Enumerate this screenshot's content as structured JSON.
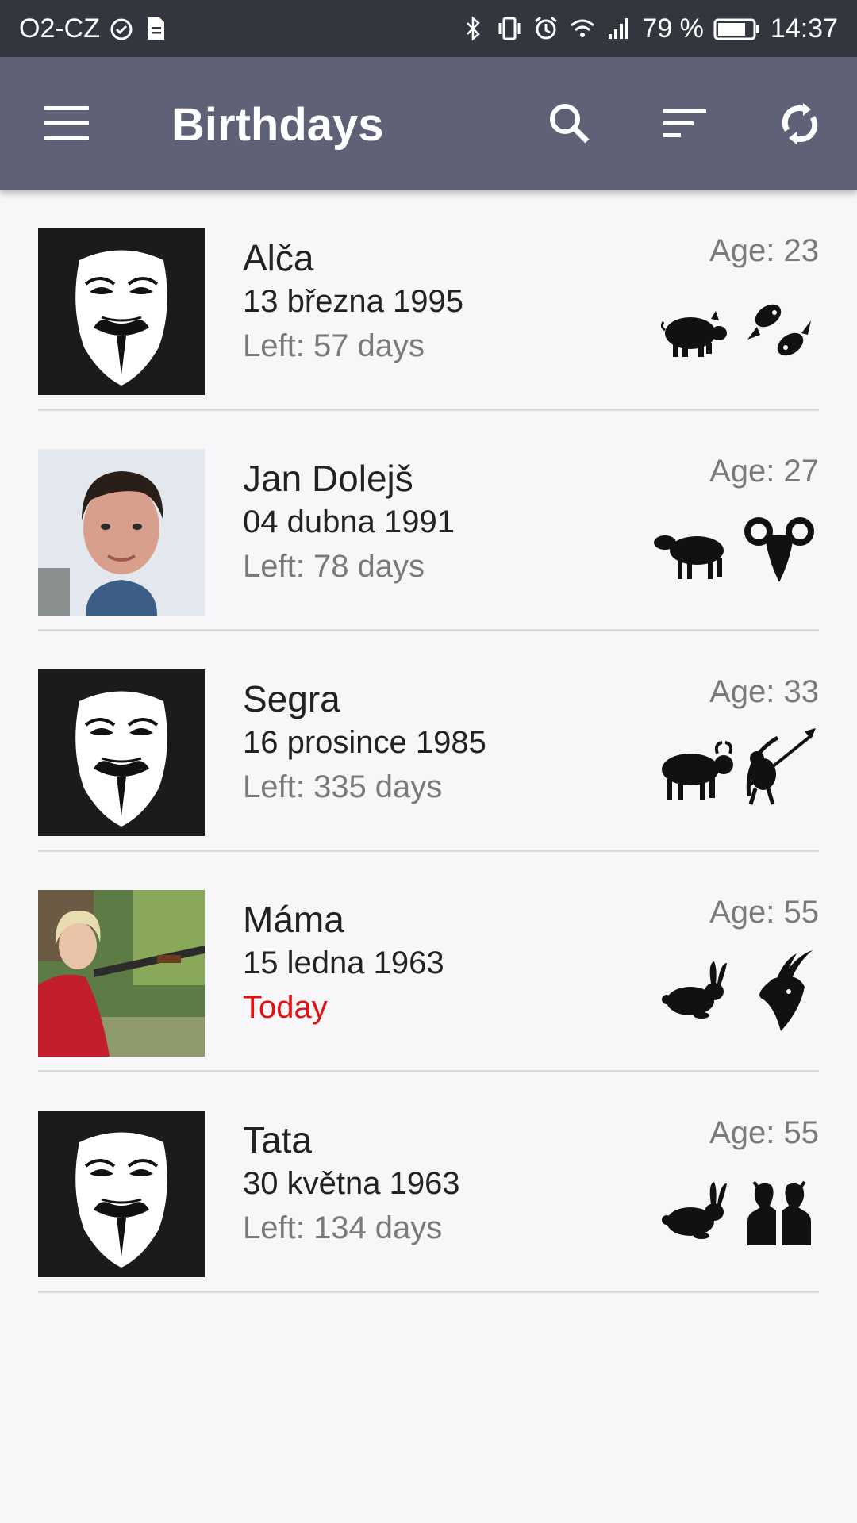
{
  "status_bar": {
    "carrier": "O2-CZ",
    "battery": "79 %",
    "time": "14:37"
  },
  "app_bar": {
    "title": "Birthdays",
    "icons": [
      "menu-icon",
      "search-icon",
      "sort-icon",
      "sync-icon"
    ]
  },
  "people": [
    {
      "name": "Alča",
      "date": "13 března 1995",
      "left": "Left: 57 days",
      "age": "Age: 23",
      "avatar": "mask",
      "chinese_zodiac": "pig-icon",
      "zodiac": "pisces-icon"
    },
    {
      "name": "Jan Dolejš",
      "date": "04 dubna 1991",
      "left": "Left: 78 days",
      "age": "Age: 27",
      "avatar": "photo-man",
      "chinese_zodiac": "sheep-icon",
      "zodiac": "aries-icon"
    },
    {
      "name": "Segra",
      "date": "16 prosince 1985",
      "left": "Left: 335 days",
      "age": "Age: 33",
      "avatar": "mask",
      "chinese_zodiac": "ox-icon",
      "zodiac": "sagittarius-icon"
    },
    {
      "name": "Máma",
      "date": "15 ledna 1963",
      "left": "Today",
      "age": "Age: 55",
      "avatar": "photo-woman",
      "chinese_zodiac": "rabbit-icon",
      "zodiac": "capricorn-icon"
    },
    {
      "name": "Tata",
      "date": "30 května 1963",
      "left": "Left: 134 days",
      "age": "Age: 55",
      "avatar": "mask",
      "chinese_zodiac": "rabbit-icon",
      "zodiac": "gemini-icon"
    }
  ],
  "colors": {
    "status_bar": "#34363f",
    "app_bar": "#5f6277",
    "today": "#e01010",
    "secondary_text": "#7a7a7a"
  }
}
